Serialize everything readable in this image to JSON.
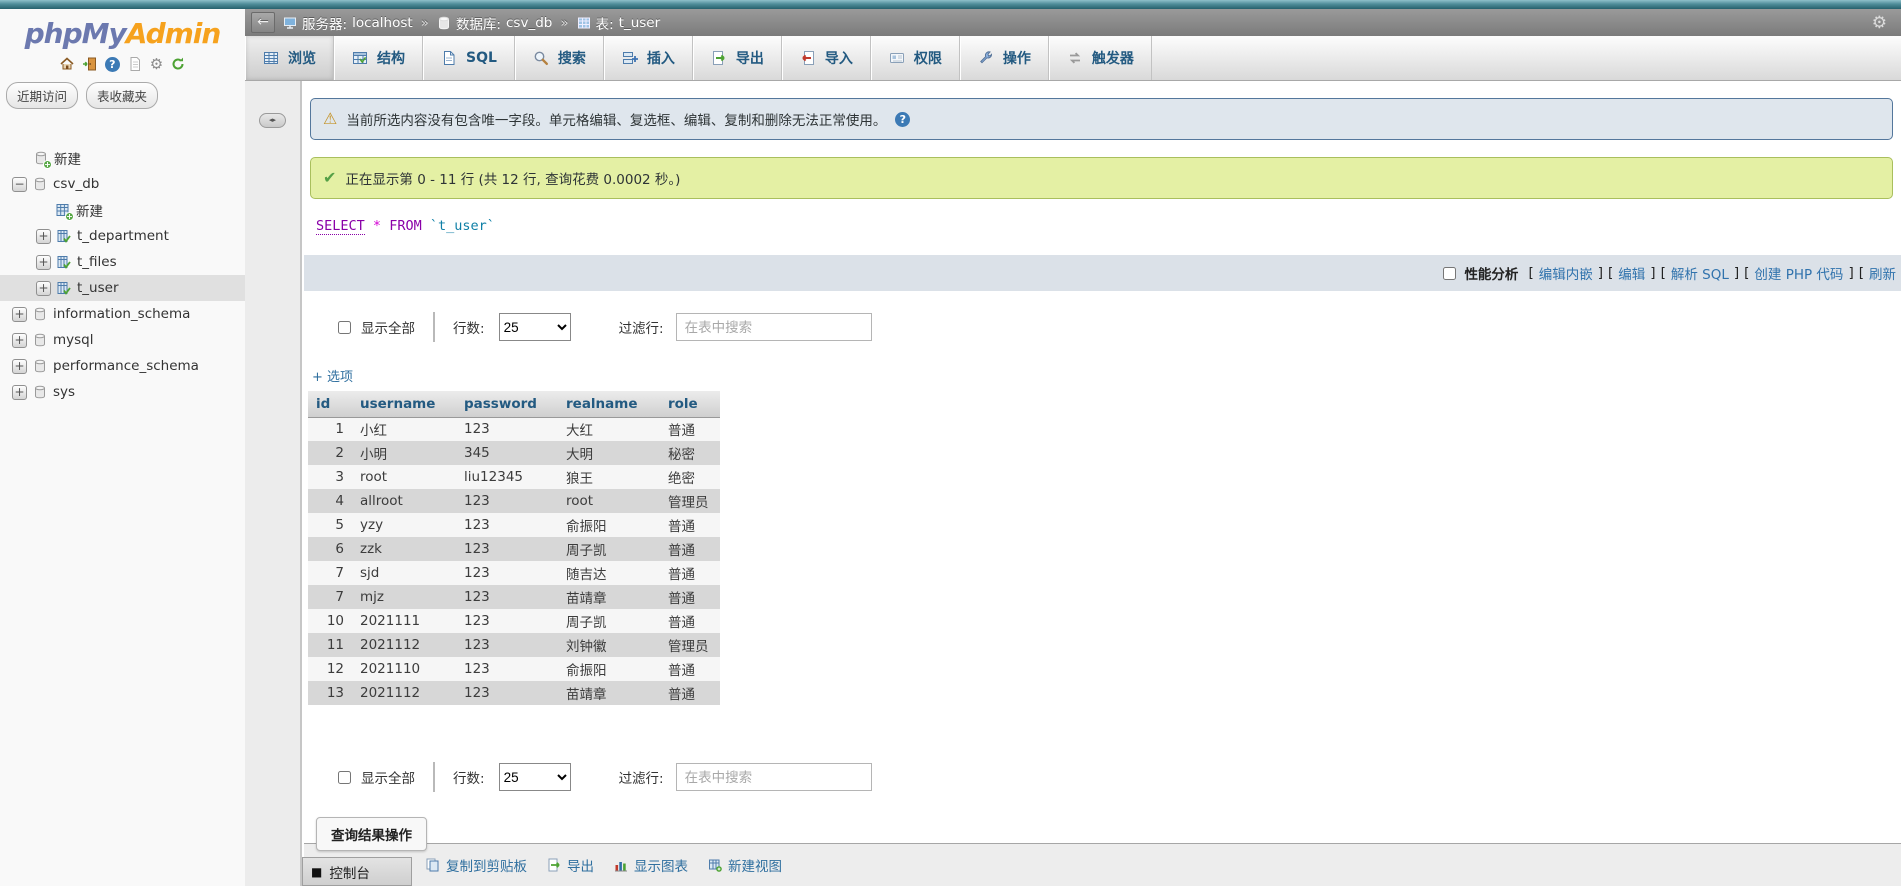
{
  "logo": {
    "part1": "phpMy",
    "part2": "Admin"
  },
  "sidebar": {
    "buttons": [
      {
        "label": "近期访问"
      },
      {
        "label": "表收藏夹"
      }
    ],
    "tree": [
      {
        "label": "新建"
      },
      {
        "label": "csv_db"
      },
      {
        "label": "新建"
      },
      {
        "label": "t_department"
      },
      {
        "label": "t_files"
      },
      {
        "label": "t_user"
      },
      {
        "label": "information_schema"
      },
      {
        "label": "mysql"
      },
      {
        "label": "performance_schema"
      },
      {
        "label": "sys"
      }
    ]
  },
  "breadcrumb": {
    "server_label": "服务器:",
    "server": "localhost",
    "sep": "»",
    "db_label": "数据库:",
    "db": "csv_db",
    "table_label": "表:",
    "table": "t_user"
  },
  "tabs": [
    {
      "label": "浏览"
    },
    {
      "label": "结构"
    },
    {
      "label": "SQL"
    },
    {
      "label": "搜索"
    },
    {
      "label": "插入"
    },
    {
      "label": "导出"
    },
    {
      "label": "导入"
    },
    {
      "label": "权限"
    },
    {
      "label": "操作"
    },
    {
      "label": "触发器"
    }
  ],
  "messages": {
    "warning": "当前所选内容没有包含唯一字段。单元格编辑、复选框、编辑、复制和删除无法正常使用。",
    "success": "正在显示第 0 - 11 行 (共 12 行, 查询花费 0.0002 秒。)"
  },
  "sql": {
    "select": "SELECT",
    "star": "*",
    "from": "FROM",
    "table": "`t_user`"
  },
  "profiling": {
    "label": "性能分析",
    "links": [
      {
        "open": "[",
        "label": "编辑内嵌",
        "close": "]"
      },
      {
        "open": "[ ",
        "label": "编辑",
        "close": " ]"
      },
      {
        "open": "[ ",
        "label": "解析 SQL",
        "close": " ]"
      },
      {
        "open": "[ ",
        "label": "创建 PHP 代码",
        "close": " ]"
      },
      {
        "open": "[ ",
        "label": "刷新",
        "close": ""
      }
    ]
  },
  "controls": {
    "show_all": "显示全部",
    "rows_label": "行数:",
    "rows_value": "25",
    "filter_label": "过滤行:",
    "filter_placeholder": "在表中搜索"
  },
  "options_link": "+ 选项",
  "table": {
    "columns": [
      "id",
      "username",
      "password",
      "realname",
      "role"
    ],
    "rows": [
      [
        "1",
        "小红",
        "123",
        "大红",
        "普通"
      ],
      [
        "2",
        "小明",
        "345",
        "大明",
        "秘密"
      ],
      [
        "3",
        "root",
        "liu12345",
        "狼王",
        "绝密"
      ],
      [
        "4",
        "allroot",
        "123",
        "root",
        "管理员"
      ],
      [
        "5",
        "yzy",
        "123",
        "俞振阳",
        "普通"
      ],
      [
        "6",
        "zzk",
        "123",
        "周子凯",
        "普通"
      ],
      [
        "7",
        "sjd",
        "123",
        "随吉达",
        "普通"
      ],
      [
        "7",
        "mjz",
        "123",
        "苗靖章",
        "普通"
      ],
      [
        "10",
        "2021111",
        "123",
        "周子凯",
        "普通"
      ],
      [
        "11",
        "2021112",
        "123",
        "刘钟徽",
        "管理员"
      ],
      [
        "12",
        "2021110",
        "123",
        "俞振阳",
        "普通"
      ],
      [
        "13",
        "2021112",
        "123",
        "苗靖章",
        "普通"
      ]
    ]
  },
  "query_ops": {
    "legend": "查询结果操作",
    "actions": [
      {
        "label": "复制到剪贴板"
      },
      {
        "label": "导出"
      },
      {
        "label": "显示图表"
      },
      {
        "label": "新建视图"
      }
    ]
  },
  "console_label": "控制台",
  "colors": {
    "accent_blue": "#235a81",
    "success_green": "#e4f0a4",
    "warning_blue": "#dfe6ed"
  }
}
